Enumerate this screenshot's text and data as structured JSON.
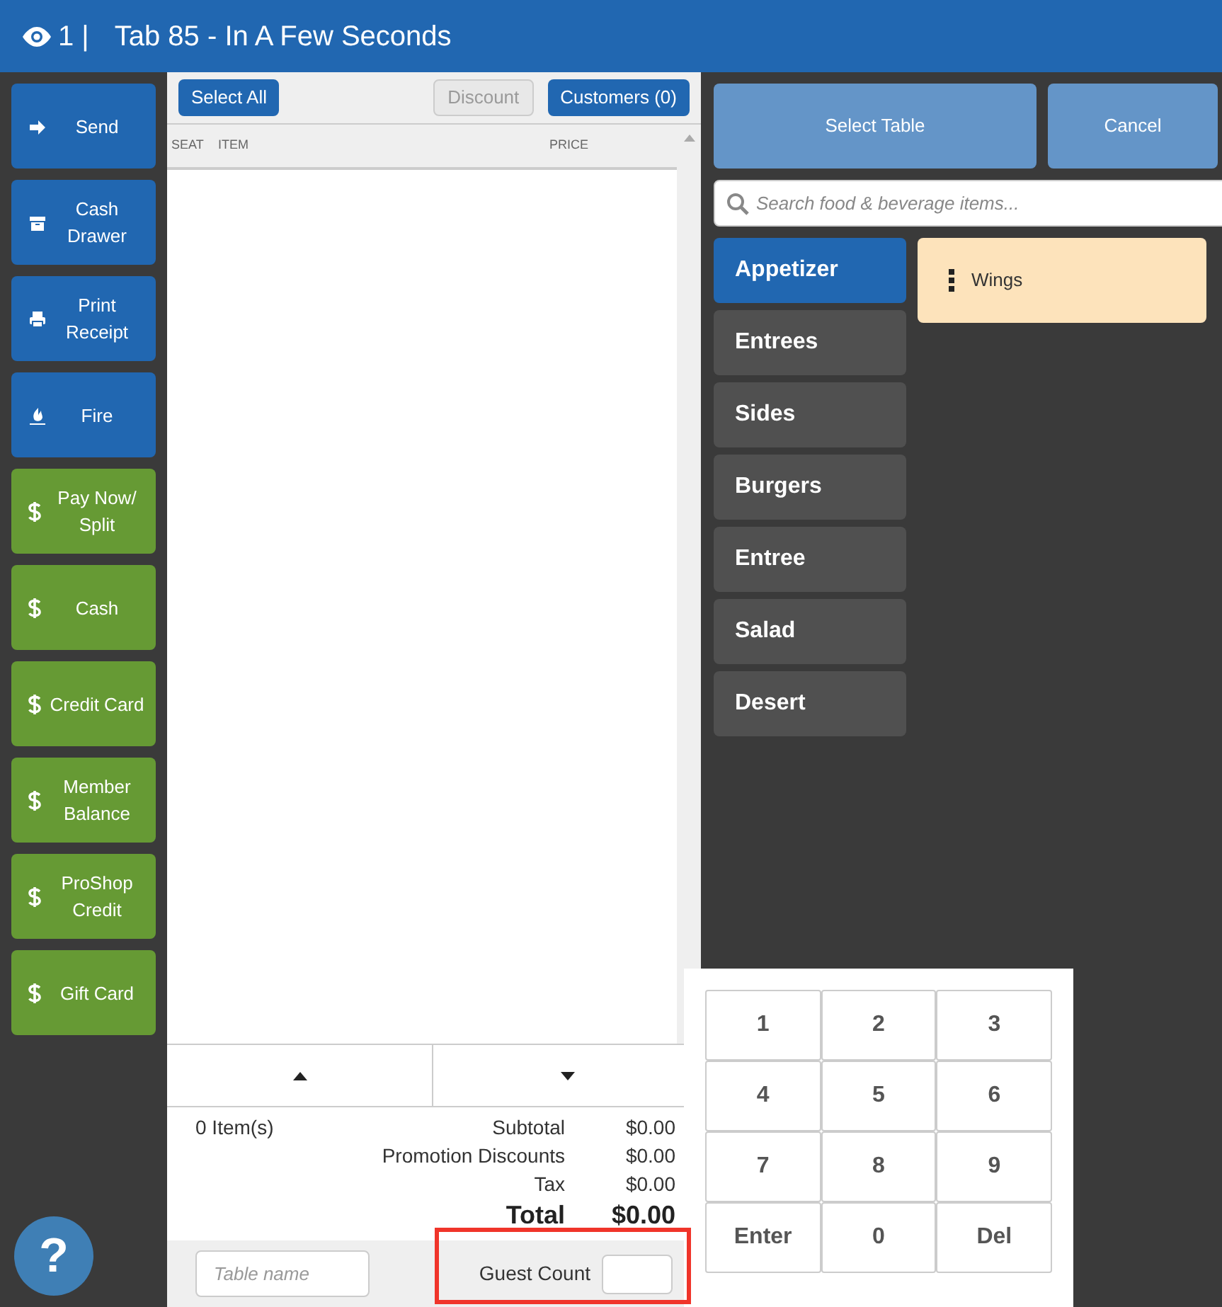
{
  "header": {
    "viewer_count": "1 |",
    "title": "Tab 85 - In A Few Seconds"
  },
  "actions": [
    {
      "label": "Send",
      "kind": "action"
    },
    {
      "label": "Cash Drawer",
      "kind": "action"
    },
    {
      "label": "Print Receipt",
      "kind": "action"
    },
    {
      "label": "Fire",
      "kind": "action"
    },
    {
      "label": "Pay Now/ Split",
      "kind": "payment"
    },
    {
      "label": "Cash",
      "kind": "payment"
    },
    {
      "label": "Credit Card",
      "kind": "payment"
    },
    {
      "label": "Member Balance",
      "kind": "payment"
    },
    {
      "label": "ProShop Credit",
      "kind": "payment"
    },
    {
      "label": "Gift Card",
      "kind": "payment"
    }
  ],
  "order": {
    "toolbar": [
      {
        "label": "Select All",
        "disabled": false
      },
      {
        "label": "Discount",
        "disabled": true
      },
      {
        "label": "Customers (0)",
        "disabled": false
      }
    ],
    "columns": [
      "SEAT",
      "ITEM",
      "PRICE"
    ],
    "item_count": "0 Item(s)",
    "totals": [
      {
        "label": "Subtotal",
        "value": "$0.00",
        "kind": "line"
      },
      {
        "label": "Promotion Discounts",
        "value": "$0.00",
        "kind": "line"
      },
      {
        "label": "Tax",
        "value": "$0.00",
        "kind": "line"
      },
      {
        "label": "Total",
        "value": "$0.00",
        "kind": "total"
      }
    ],
    "table_name": {
      "placeholder": "Table name"
    },
    "guest_count": {
      "label": "Guest Count",
      "highlighted": true
    }
  },
  "menu": {
    "buttons": [
      "Select Table",
      "Cancel"
    ],
    "search": {
      "placeholder": "Search food & beverage items..."
    },
    "categories": [
      {
        "label": "Appetizer",
        "selected": true
      },
      {
        "label": "Entrees",
        "selected": false
      },
      {
        "label": "Sides",
        "selected": false
      },
      {
        "label": "Burgers",
        "selected": false
      },
      {
        "label": "Entree",
        "selected": false
      },
      {
        "label": "Salad",
        "selected": false
      },
      {
        "label": "Desert",
        "selected": false
      }
    ],
    "items": [
      "Wings"
    ]
  },
  "keypad": [
    "1",
    "2",
    "3",
    "4",
    "5",
    "6",
    "7",
    "8",
    "9",
    "Enter",
    "0",
    "Del"
  ],
  "help": "?"
}
